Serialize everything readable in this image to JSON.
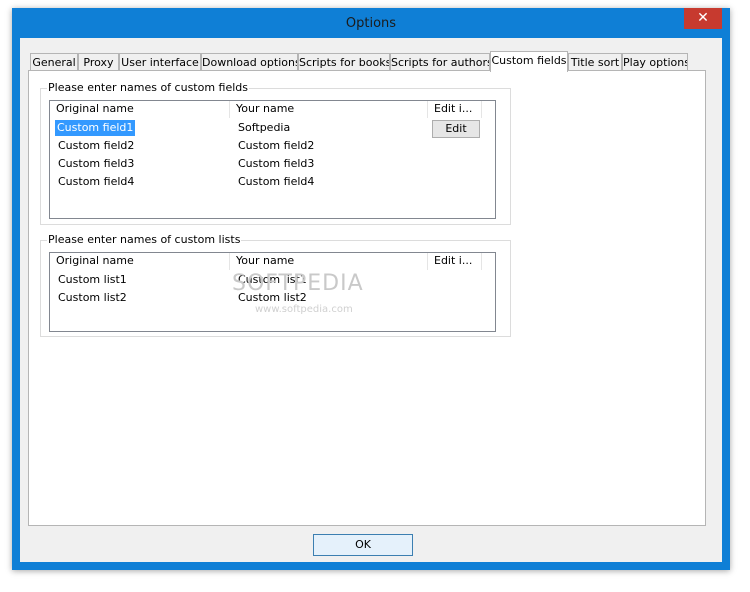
{
  "window": {
    "title": "Options",
    "close_glyph": "✕"
  },
  "tabs": [
    {
      "label": "General",
      "active": false
    },
    {
      "label": "Proxy",
      "active": false
    },
    {
      "label": "User interface",
      "active": false
    },
    {
      "label": "Download options",
      "active": false
    },
    {
      "label": "Scripts for books",
      "active": false
    },
    {
      "label": "Scripts for authors",
      "active": false
    },
    {
      "label": "Custom fields",
      "active": true
    },
    {
      "label": "Title sort",
      "active": false
    },
    {
      "label": "Play options",
      "active": false
    }
  ],
  "custom_fields": {
    "group_label": "Please enter names of custom fields",
    "columns": [
      "Original name",
      "Your name",
      "Edit i..."
    ],
    "rows": [
      {
        "original": "Custom field1",
        "yours": "Softpedia",
        "selected": true
      },
      {
        "original": "Custom field2",
        "yours": "Custom field2",
        "selected": false
      },
      {
        "original": "Custom field3",
        "yours": "Custom field3",
        "selected": false
      },
      {
        "original": "Custom field4",
        "yours": "Custom field4",
        "selected": false
      }
    ],
    "edit_button_label": "Edit"
  },
  "custom_lists": {
    "group_label": "Please enter names of custom lists",
    "columns": [
      "Original name",
      "Your name",
      "Edit i..."
    ],
    "rows": [
      {
        "original": "Custom list1",
        "yours": "Custom list1"
      },
      {
        "original": "Custom list2",
        "yours": "Custom list2"
      }
    ]
  },
  "watermark": {
    "text": "SOFTPEDIA",
    "sub": "www.softpedia.com"
  },
  "footer": {
    "ok_label": "OK"
  },
  "colors": {
    "frame": "#0f7fd6",
    "selection": "#3399ff",
    "close_button": "#c73a2f"
  }
}
